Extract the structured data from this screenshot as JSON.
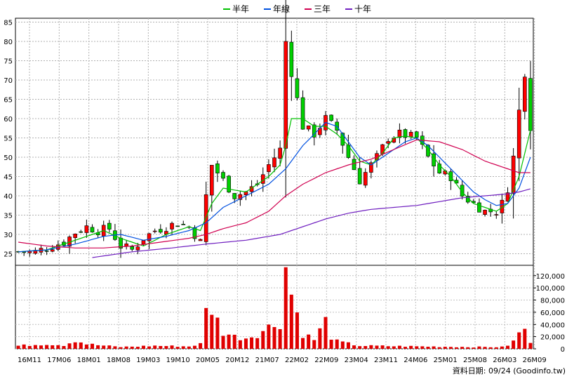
{
  "chart_data": {
    "type": "candlestick",
    "legend": [
      {
        "name": "半年",
        "color": "#00c000"
      },
      {
        "name": "年線",
        "color": "#0050e0"
      },
      {
        "name": "三年",
        "color": "#d00050"
      },
      {
        "name": "十年",
        "color": "#7020c0"
      }
    ],
    "price_axis": {
      "ylim": [
        22,
        86
      ],
      "ticks": [
        25,
        30,
        35,
        40,
        45,
        50,
        55,
        60,
        65,
        70,
        75,
        80,
        85
      ]
    },
    "volume_axis": {
      "ylim": [
        0,
        137000
      ],
      "ticks": [
        0,
        20000,
        40000,
        60000,
        80000,
        100000,
        120000
      ],
      "tick_labels": [
        "0",
        "20,000",
        "40,000",
        "60,000",
        "80,000",
        "100,000",
        "120,000"
      ]
    },
    "x_labels": [
      "16M11",
      "17M06",
      "18M01",
      "18M08",
      "19M03",
      "19M10",
      "20M05",
      "20M12",
      "21M07",
      "22M02",
      "22M09",
      "23M04",
      "23M11",
      "24M06",
      "25M01",
      "25M08",
      "26M03",
      "26M09"
    ],
    "price_anchors": [
      [
        0,
        25.5
      ],
      [
        3,
        25.5
      ],
      [
        5,
        26.5
      ],
      [
        8,
        28
      ],
      [
        10,
        30.5
      ],
      [
        12,
        32
      ],
      [
        14,
        31
      ],
      [
        16,
        31.5
      ],
      [
        18,
        27
      ],
      [
        20,
        26
      ],
      [
        22,
        29
      ],
      [
        24,
        31
      ],
      [
        26,
        32
      ],
      [
        28,
        33
      ],
      [
        30,
        32
      ],
      [
        32,
        28
      ],
      [
        33,
        40
      ],
      [
        34,
        48
      ],
      [
        36,
        44
      ],
      [
        38,
        40
      ],
      [
        40,
        41
      ],
      [
        42,
        43
      ],
      [
        44,
        48
      ],
      [
        46,
        52
      ],
      [
        47,
        80
      ],
      [
        48,
        72
      ],
      [
        50,
        58
      ],
      [
        52,
        56
      ],
      [
        54,
        60
      ],
      [
        56,
        57
      ],
      [
        58,
        50
      ],
      [
        60,
        44
      ],
      [
        62,
        48
      ],
      [
        63,
        50
      ],
      [
        65,
        55
      ],
      [
        67,
        56
      ],
      [
        70,
        55
      ],
      [
        72,
        50
      ],
      [
        74,
        46
      ],
      [
        76,
        45
      ],
      [
        78,
        40
      ],
      [
        80,
        38
      ],
      [
        82,
        36
      ],
      [
        84,
        36
      ],
      [
        85,
        38
      ],
      [
        86,
        42
      ],
      [
        87,
        50
      ],
      [
        88,
        62
      ],
      [
        89,
        72
      ],
      [
        90,
        58
      ]
    ],
    "volume_anchors": [
      [
        0,
        5000
      ],
      [
        5,
        8000
      ],
      [
        8,
        6000
      ],
      [
        10,
        14000
      ],
      [
        12,
        8000
      ],
      [
        14,
        6000
      ],
      [
        18,
        3000
      ],
      [
        24,
        5000
      ],
      [
        30,
        4000
      ],
      [
        32,
        8000
      ],
      [
        33,
        60000
      ],
      [
        34,
        68000
      ],
      [
        35,
        45000
      ],
      [
        36,
        28000
      ],
      [
        38,
        20000
      ],
      [
        40,
        18000
      ],
      [
        42,
        25000
      ],
      [
        44,
        35000
      ],
      [
        46,
        45000
      ],
      [
        47,
        134000
      ],
      [
        48,
        92000
      ],
      [
        49,
        58000
      ],
      [
        50,
        25000
      ],
      [
        52,
        15000
      ],
      [
        54,
        45000
      ],
      [
        55,
        20000
      ],
      [
        56,
        12000
      ],
      [
        60,
        5000
      ],
      [
        70,
        4000
      ],
      [
        80,
        3000
      ],
      [
        85,
        3000
      ],
      [
        86,
        6000
      ],
      [
        87,
        12000
      ],
      [
        88,
        25000
      ],
      [
        89,
        35000
      ],
      [
        90,
        8000
      ]
    ],
    "ma_half": [
      [
        0,
        25.5
      ],
      [
        5,
        26
      ],
      [
        10,
        28.5
      ],
      [
        15,
        31
      ],
      [
        18,
        29
      ],
      [
        22,
        27
      ],
      [
        26,
        30
      ],
      [
        30,
        32
      ],
      [
        32,
        31
      ],
      [
        34,
        38
      ],
      [
        36,
        42
      ],
      [
        40,
        41
      ],
      [
        44,
        45
      ],
      [
        46,
        48
      ],
      [
        47,
        53
      ],
      [
        48,
        60
      ],
      [
        50,
        60
      ],
      [
        52,
        58
      ],
      [
        54,
        58
      ],
      [
        56,
        56
      ],
      [
        58,
        53
      ],
      [
        60,
        49
      ],
      [
        62,
        48
      ],
      [
        64,
        51
      ],
      [
        66,
        55
      ],
      [
        68,
        55.5
      ],
      [
        70,
        55
      ],
      [
        72,
        52
      ],
      [
        74,
        48
      ],
      [
        76,
        45
      ],
      [
        78,
        41
      ],
      [
        80,
        38
      ],
      [
        82,
        37
      ],
      [
        84,
        36
      ],
      [
        86,
        38
      ],
      [
        88,
        45
      ],
      [
        90,
        57
      ]
    ],
    "ma_year": [
      [
        0,
        25.5
      ],
      [
        5,
        26
      ],
      [
        10,
        27.5
      ],
      [
        15,
        29.5
      ],
      [
        18,
        30
      ],
      [
        22,
        28.5
      ],
      [
        26,
        29.5
      ],
      [
        30,
        31
      ],
      [
        33,
        33
      ],
      [
        36,
        37
      ],
      [
        40,
        40
      ],
      [
        44,
        43
      ],
      [
        47,
        47
      ],
      [
        50,
        53
      ],
      [
        52,
        56
      ],
      [
        54,
        59
      ],
      [
        56,
        58
      ],
      [
        58,
        54
      ],
      [
        60,
        50
      ],
      [
        62,
        48
      ],
      [
        64,
        50
      ],
      [
        66,
        52
      ],
      [
        68,
        54
      ],
      [
        70,
        55
      ],
      [
        72,
        53
      ],
      [
        74,
        50
      ],
      [
        76,
        47
      ],
      [
        78,
        44
      ],
      [
        80,
        41
      ],
      [
        82,
        39
      ],
      [
        84,
        37.5
      ],
      [
        86,
        38
      ],
      [
        88,
        42
      ],
      [
        90,
        50
      ]
    ],
    "ma_three": [
      [
        0,
        28
      ],
      [
        5,
        27
      ],
      [
        10,
        26.5
      ],
      [
        15,
        26.5
      ],
      [
        20,
        27
      ],
      [
        25,
        28
      ],
      [
        30,
        29
      ],
      [
        33,
        30
      ],
      [
        36,
        31.5
      ],
      [
        40,
        33
      ],
      [
        44,
        36
      ],
      [
        47,
        40
      ],
      [
        50,
        43
      ],
      [
        54,
        46
      ],
      [
        58,
        48
      ],
      [
        62,
        49.5
      ],
      [
        66,
        52
      ],
      [
        70,
        54.5
      ],
      [
        74,
        54
      ],
      [
        78,
        52
      ],
      [
        82,
        49
      ],
      [
        86,
        47
      ],
      [
        88,
        46
      ],
      [
        90,
        46
      ]
    ],
    "ma_ten": [
      [
        13,
        24
      ],
      [
        20,
        25.5
      ],
      [
        27,
        26.5
      ],
      [
        33,
        27.5
      ],
      [
        40,
        28.5
      ],
      [
        46,
        30
      ],
      [
        50,
        32
      ],
      [
        54,
        34
      ],
      [
        58,
        35.5
      ],
      [
        62,
        36.5
      ],
      [
        66,
        37
      ],
      [
        70,
        37.5
      ],
      [
        74,
        38.5
      ],
      [
        78,
        39.5
      ],
      [
        82,
        40
      ],
      [
        86,
        40.5
      ],
      [
        88,
        41
      ],
      [
        90,
        41.8
      ]
    ],
    "footer": "資料日期: 09/24  (Goodinfo.tw)"
  }
}
